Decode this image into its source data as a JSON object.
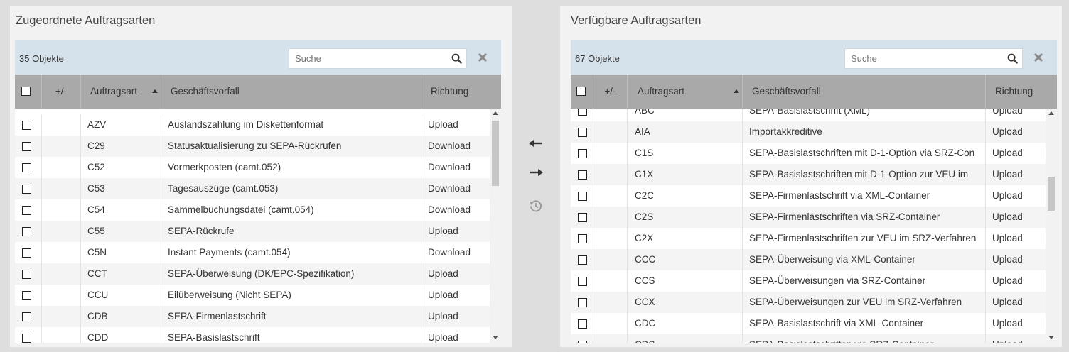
{
  "left": {
    "title": "Zugeordnete Auftragsarten",
    "count": "35 Objekte",
    "search_placeholder": "Suche",
    "columns": {
      "plusminus": "+/-",
      "type": "Auftragsart",
      "business": "Geschäftsvorfall",
      "direction": "Richtung"
    },
    "rows": [
      {
        "type": "AZV",
        "business": "Auslandszahlung im Diskettenformat",
        "direction": "Upload"
      },
      {
        "type": "C29",
        "business": "Statusaktualisierung zu SEPA-Rückrufen",
        "direction": "Download"
      },
      {
        "type": "C52",
        "business": "Vormerkposten (camt.052)",
        "direction": "Download"
      },
      {
        "type": "C53",
        "business": "Tagesauszüge (camt.053)",
        "direction": "Download"
      },
      {
        "type": "C54",
        "business": "Sammelbuchungsdatei (camt.054)",
        "direction": "Download"
      },
      {
        "type": "C55",
        "business": "SEPA-Rückrufe",
        "direction": "Upload"
      },
      {
        "type": "C5N",
        "business": "Instant Payments (camt.054)",
        "direction": "Download"
      },
      {
        "type": "CCT",
        "business": "SEPA-Überweisung (DK/EPC-Spezifikation)",
        "direction": "Upload"
      },
      {
        "type": "CCU",
        "business": "Eilüberweisung (Nicht SEPA)",
        "direction": "Upload"
      },
      {
        "type": "CDB",
        "business": "SEPA-Firmenlastschrift",
        "direction": "Upload"
      },
      {
        "type": "CDD",
        "business": "SEPA-Basislastschrift",
        "direction": "Upload"
      }
    ]
  },
  "right": {
    "title": "Verfügbare Auftragsarten",
    "count": "67 Objekte",
    "search_placeholder": "Suche",
    "columns": {
      "plusminus": "+/-",
      "type": "Auftragsart",
      "business": "Geschäftsvorfall",
      "direction": "Richtung"
    },
    "rows": [
      {
        "type": "ABC",
        "business": "SEPA-Basislastschrift (XML)",
        "direction": "Upload"
      },
      {
        "type": "AIA",
        "business": "Importakkreditive",
        "direction": "Upload"
      },
      {
        "type": "C1S",
        "business": "SEPA-Basislastschriften mit D-1-Option via SRZ-Con",
        "direction": "Upload"
      },
      {
        "type": "C1X",
        "business": "SEPA-Basislastschriften mit D-1-Option zur VEU im",
        "direction": "Upload"
      },
      {
        "type": "C2C",
        "business": "SEPA-Firmenlastschrift via XML-Container",
        "direction": "Upload"
      },
      {
        "type": "C2S",
        "business": "SEPA-Firmenlastschriften via SRZ-Container",
        "direction": "Upload"
      },
      {
        "type": "C2X",
        "business": "SEPA-Firmenlastschriften zur VEU im SRZ-Verfahren",
        "direction": "Upload"
      },
      {
        "type": "CCC",
        "business": "SEPA-Überweisung via XML-Container",
        "direction": "Upload"
      },
      {
        "type": "CCS",
        "business": "SEPA-Überweisungen via SRZ-Container",
        "direction": "Upload"
      },
      {
        "type": "CCX",
        "business": "SEPA-Überweisungen zur VEU im SRZ-Verfahren",
        "direction": "Upload"
      },
      {
        "type": "CDC",
        "business": "SEPA-Basislastschrift via XML-Container",
        "direction": "Upload"
      },
      {
        "type": "CDS",
        "business": "SEPA-Basislastschriften via SRZ-Container",
        "direction": "Upload"
      }
    ]
  },
  "icons": {
    "move_left": "arrow-left-icon",
    "move_right": "arrow-right-icon",
    "reset": "history-icon",
    "search": "search-icon",
    "clear": "close-icon"
  }
}
